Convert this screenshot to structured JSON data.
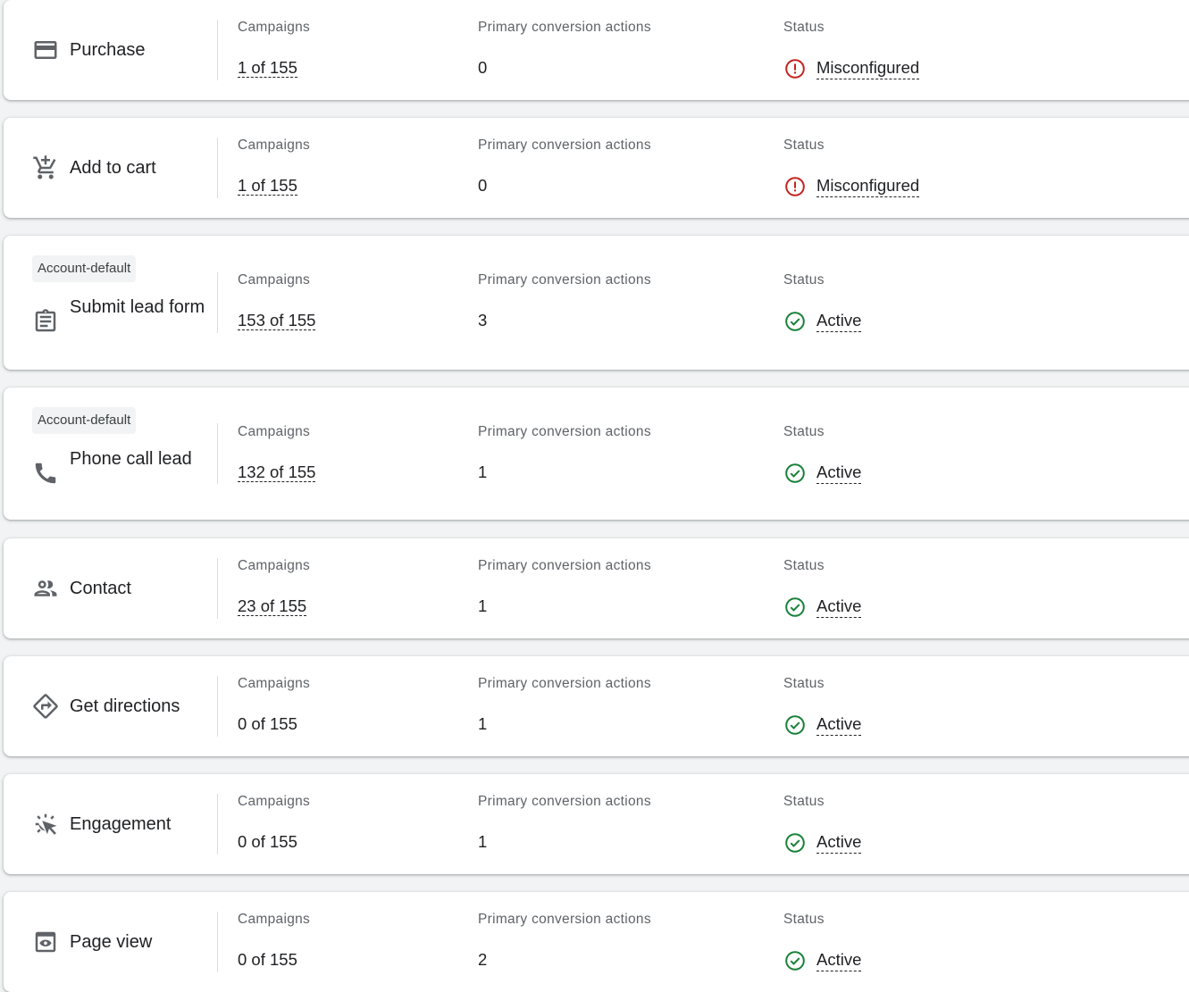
{
  "labels": {
    "campaigns": "Campaigns",
    "primary": "Primary conversion actions",
    "status": "Status"
  },
  "colors": {
    "active": "#188038",
    "misconfigured": "#c5221f",
    "background": "#f1f3f4"
  },
  "goals": [
    {
      "name": "Purchase",
      "icon": "credit-card-icon",
      "chip": "",
      "campaigns": "1 of 155",
      "campaigns_link": true,
      "primary": "0",
      "status": "Misconfigured",
      "status_type": "error"
    },
    {
      "name": "Add to cart",
      "icon": "cart-add-icon",
      "chip": "",
      "campaigns": "1 of 155",
      "campaigns_link": true,
      "primary": "0",
      "status": "Misconfigured",
      "status_type": "error"
    },
    {
      "name": "Submit lead form",
      "icon": "clipboard-icon",
      "chip": "Account-default",
      "campaigns": "153 of 155",
      "campaigns_link": true,
      "primary": "3",
      "status": "Active",
      "status_type": "ok"
    },
    {
      "name": "Phone call lead",
      "icon": "phone-icon",
      "chip": "Account-default",
      "campaigns": "132 of 155",
      "campaigns_link": true,
      "primary": "1",
      "status": "Active",
      "status_type": "ok"
    },
    {
      "name": "Contact",
      "icon": "people-icon",
      "chip": "",
      "campaigns": "23 of 155",
      "campaigns_link": true,
      "primary": "1",
      "status": "Active",
      "status_type": "ok"
    },
    {
      "name": "Get directions",
      "icon": "directions-icon",
      "chip": "",
      "campaigns": "0 of 155",
      "campaigns_link": false,
      "primary": "1",
      "status": "Active",
      "status_type": "ok"
    },
    {
      "name": "Engagement",
      "icon": "click-icon",
      "chip": "",
      "campaigns": "0 of 155",
      "campaigns_link": false,
      "primary": "1",
      "status": "Active",
      "status_type": "ok"
    },
    {
      "name": "Page view",
      "icon": "page-view-icon",
      "chip": "",
      "campaigns": "0 of 155",
      "campaigns_link": false,
      "primary": "2",
      "status": "Active",
      "status_type": "ok"
    }
  ]
}
